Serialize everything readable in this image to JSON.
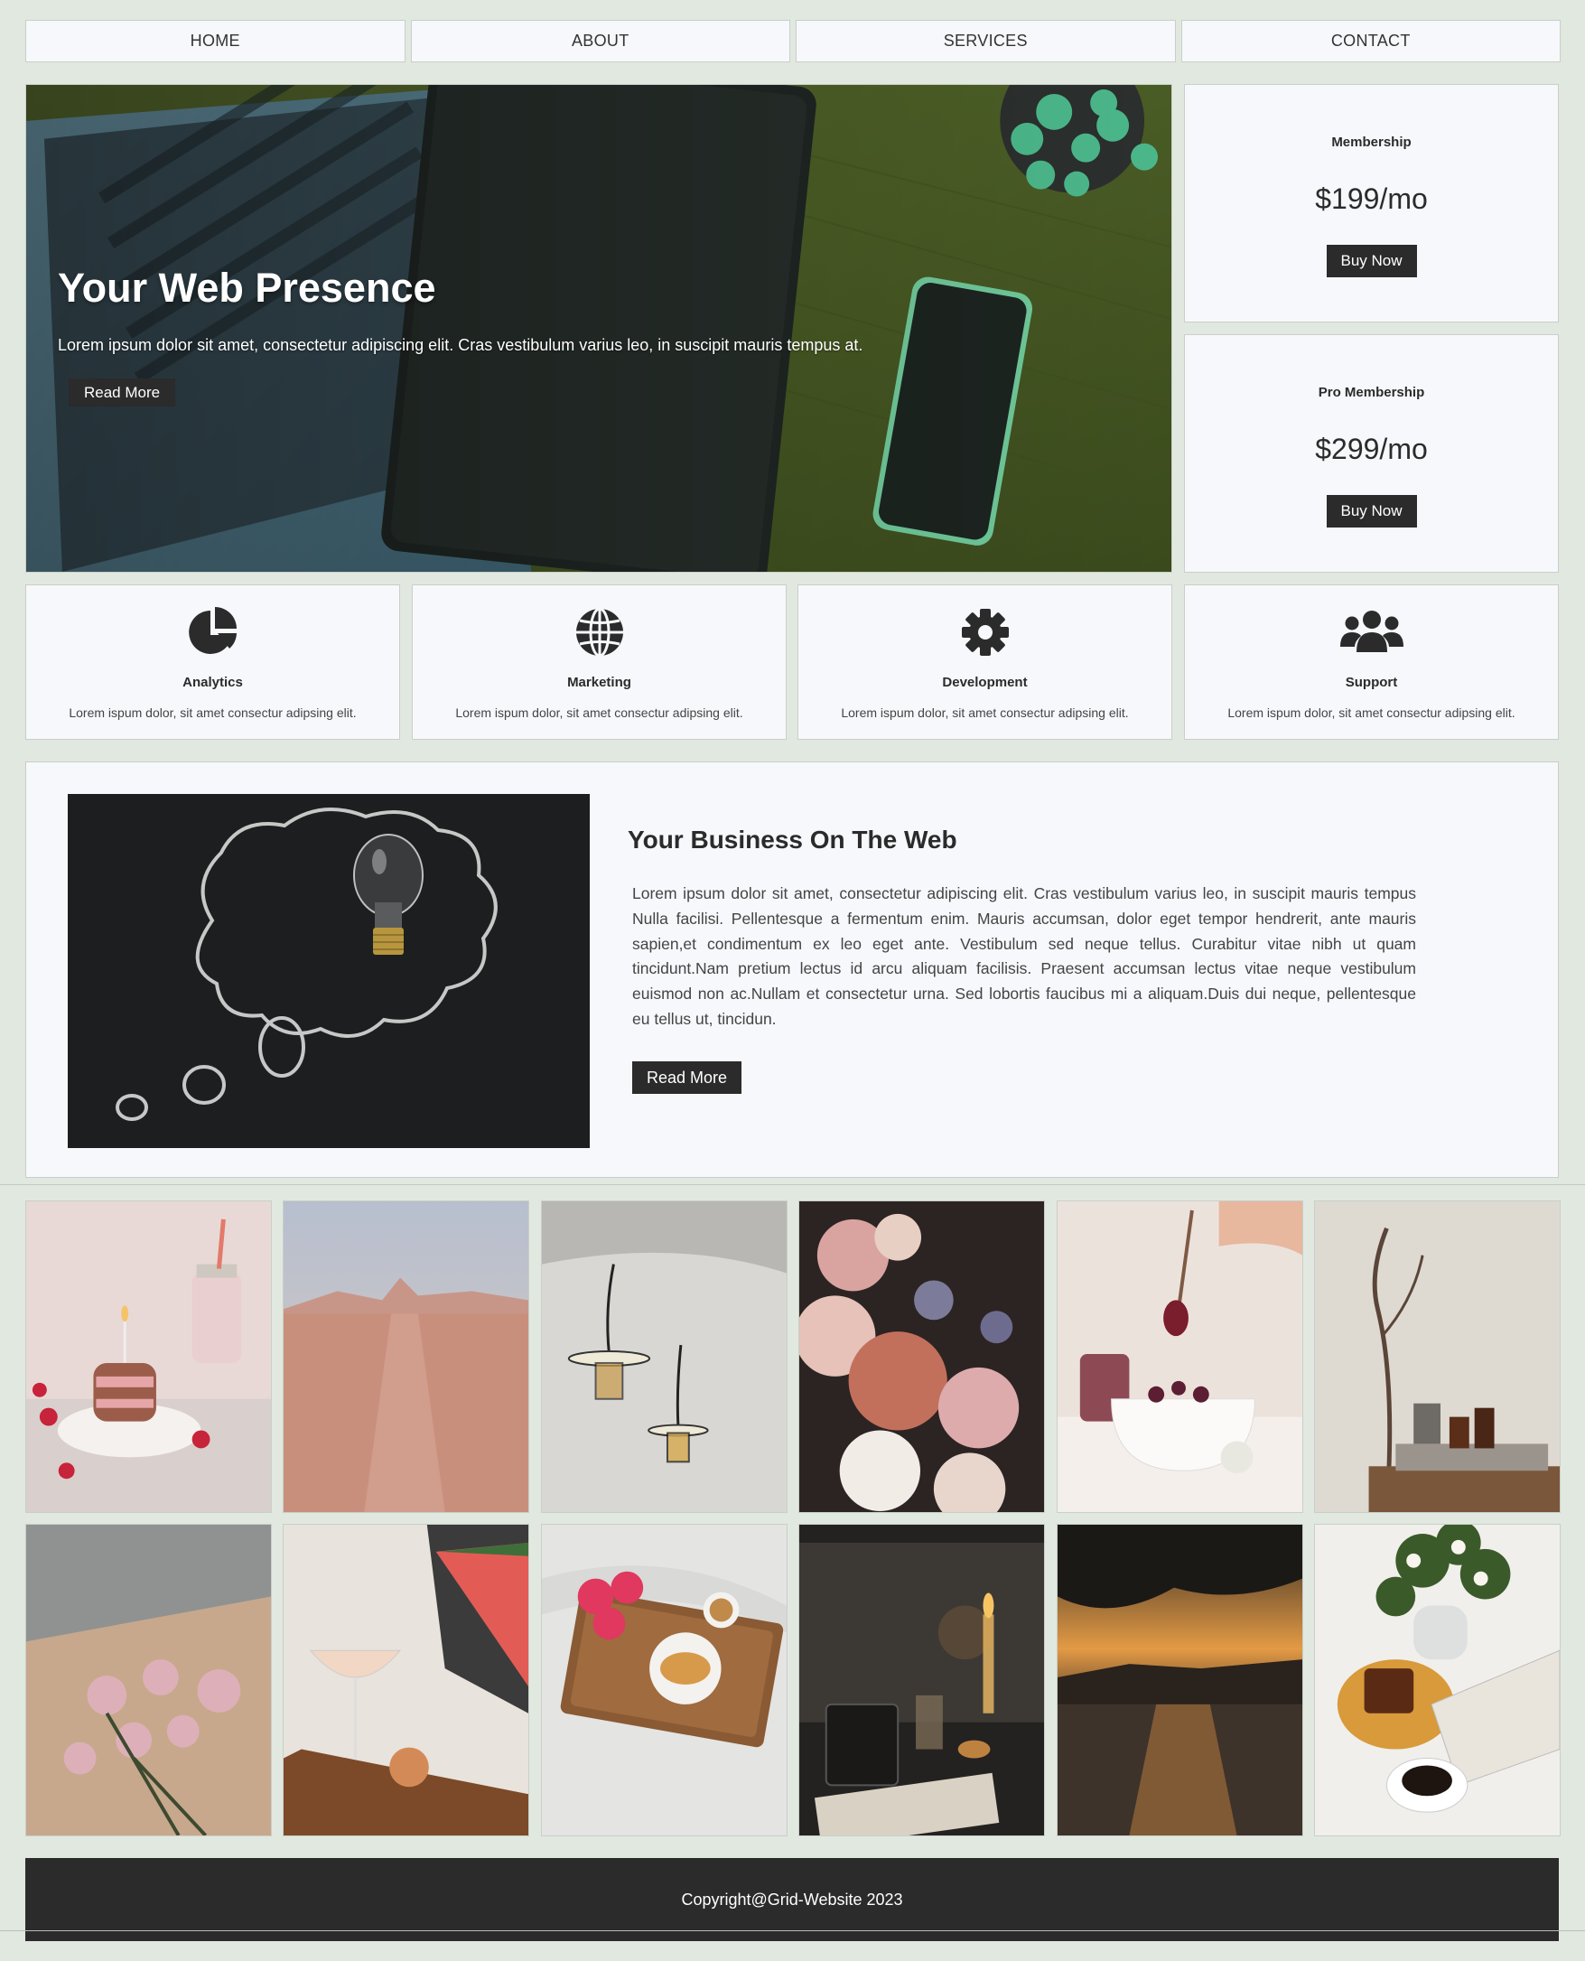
{
  "nav": {
    "items": [
      {
        "label": "HOME"
      },
      {
        "label": "ABOUT"
      },
      {
        "label": "SERVICES"
      },
      {
        "label": "CONTACT"
      }
    ]
  },
  "hero": {
    "title": "Your Web Presence",
    "text": "Lorem ipsum dolor sit amet, consectetur adipiscing elit. Cras vestibulum varius leo, in suscipit mauris tempus at.",
    "button_label": "Read More"
  },
  "pricing": [
    {
      "title": "Membership",
      "price": "$199/mo",
      "button_label": "Buy Now"
    },
    {
      "title": "Pro Membership",
      "price": "$299/mo",
      "button_label": "Buy Now"
    }
  ],
  "features": [
    {
      "icon": "pie-chart-icon",
      "title": "Analytics",
      "text": "Lorem ispum dolor, sit amet consectur adipsing elit."
    },
    {
      "icon": "globe-icon",
      "title": "Marketing",
      "text": "Lorem ispum dolor, sit amet consectur adipsing elit."
    },
    {
      "icon": "gear-icon",
      "title": "Development",
      "text": "Lorem ispum dolor, sit amet consectur adipsing elit."
    },
    {
      "icon": "users-icon",
      "title": "Support",
      "text": "Lorem ispum dolor, sit amet consectur adipsing elit."
    }
  ],
  "about": {
    "title": "Your Business On The Web",
    "text": "Lorem ipsum dolor sit amet, consectetur adipiscing elit. Cras vestibulum varius leo, in suscipit mauris tempus Nulla facilisi. Pellentesque a fermentum enim. Mauris accumsan, dolor eget tempor hendrerit, ante mauris sapien,et condimentum ex leo eget ante. Vestibulum sed neque tellus. Curabitur vitae nibh ut quam tincidunt.Nam pretium lectus id arcu aliquam facilisis. Praesent accumsan lectus vitae neque vestibulum euismod non ac.Nullam et consectetur urna. Sed lobortis faucibus mi a aliquam.Duis dui neque, pellentesque eu tellus ut, tincidun.",
    "button_label": "Read More"
  },
  "gallery": [
    {
      "subject": "pancake-cake-photo"
    },
    {
      "subject": "desert-photo"
    },
    {
      "subject": "hanging-lamps-photo"
    },
    {
      "subject": "flower-bouquet-photo"
    },
    {
      "subject": "berry-bowl-photo"
    },
    {
      "subject": "branch-still-life-photo"
    },
    {
      "subject": "peonies-on-paper-photo"
    },
    {
      "subject": "watermelon-drink-photo"
    },
    {
      "subject": "breakfast-tray-photo"
    },
    {
      "subject": "candle-window-photo"
    },
    {
      "subject": "sunset-lake-photo"
    },
    {
      "subject": "coffee-candle-photo"
    }
  ],
  "footer": {
    "text": "Copyright@Grid-Website 2023"
  },
  "colors": {
    "background": "#e1e8df",
    "card": "#f7f8fc",
    "dark": "#2b2b2b"
  }
}
